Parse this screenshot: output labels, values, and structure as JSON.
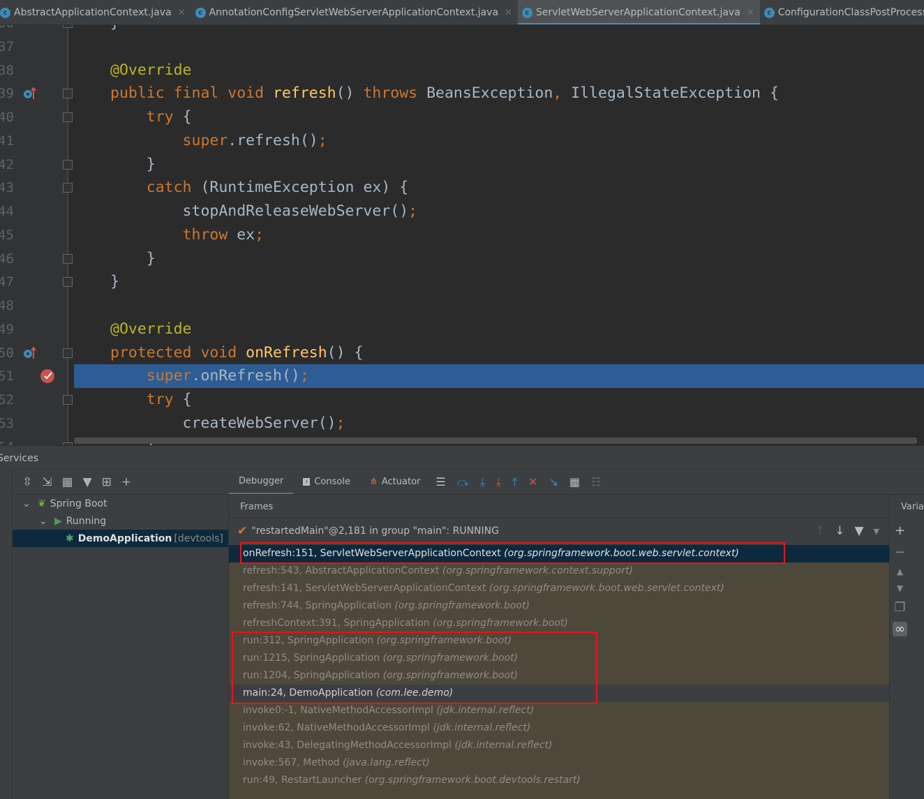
{
  "tabs": [
    {
      "label": "AbstractApplicationContext.java",
      "active": false
    },
    {
      "label": "AnnotationConfigServletWebServerApplicationContext.java",
      "active": false
    },
    {
      "label": "ServletWebServerApplicationContext.java",
      "active": true
    },
    {
      "label": "ConfigurationClassPostProcessor.java",
      "active": false
    }
  ],
  "editor": {
    "lines": [
      {
        "n": "36",
        "tokens": [
          [
            "}",
            "pl"
          ]
        ],
        "fold": true
      },
      {
        "n": "37",
        "tokens": []
      },
      {
        "n": "38",
        "tokens": [
          [
            "@Override",
            "an"
          ]
        ]
      },
      {
        "n": "39",
        "tokens": [
          [
            "public final void ",
            "kw"
          ],
          [
            "refresh",
            "md"
          ],
          [
            "() ",
            "pl"
          ],
          [
            "throws ",
            "kw"
          ],
          [
            "BeansException",
            "pl"
          ],
          [
            ", ",
            "kw"
          ],
          [
            "IllegalStateException {",
            "pl"
          ]
        ],
        "gutter": "override-icon",
        "fold": true
      },
      {
        "n": "40",
        "tokens": [
          [
            "    try ",
            "kw"
          ],
          [
            "{",
            "pl"
          ]
        ],
        "fold": true
      },
      {
        "n": "41",
        "tokens": [
          [
            "        super",
            "kw"
          ],
          [
            ".refresh()",
            "pl"
          ],
          [
            ";",
            "kw"
          ]
        ]
      },
      {
        "n": "42",
        "tokens": [
          [
            "    }",
            "pl"
          ]
        ],
        "fold": true
      },
      {
        "n": "43",
        "tokens": [
          [
            "    catch ",
            "kw"
          ],
          [
            "(RuntimeException ex) {",
            "pl"
          ]
        ],
        "fold": true
      },
      {
        "n": "44",
        "tokens": [
          [
            "        stopAndReleaseWebServer()",
            "pl"
          ],
          [
            ";",
            "kw"
          ]
        ]
      },
      {
        "n": "45",
        "tokens": [
          [
            "        throw ",
            "kw"
          ],
          [
            "ex",
            "pl"
          ],
          [
            ";",
            "kw"
          ]
        ]
      },
      {
        "n": "46",
        "tokens": [
          [
            "    }",
            "pl"
          ]
        ],
        "fold": true
      },
      {
        "n": "47",
        "tokens": [
          [
            "}",
            "pl"
          ]
        ],
        "fold": true
      },
      {
        "n": "48",
        "tokens": []
      },
      {
        "n": "49",
        "tokens": [
          [
            "@Override",
            "an"
          ]
        ]
      },
      {
        "n": "50",
        "tokens": [
          [
            "protected void ",
            "kw"
          ],
          [
            "onRefresh",
            "md"
          ],
          [
            "() {",
            "pl"
          ]
        ],
        "gutter": "override-icon",
        "fold": true
      },
      {
        "n": "51",
        "tokens": [
          [
            "    super",
            "kw"
          ],
          [
            ".onRefresh()",
            "pl"
          ],
          [
            ";",
            "kw"
          ]
        ],
        "gutter": "breakpoint-icon",
        "current": true
      },
      {
        "n": "52",
        "tokens": [
          [
            "    try ",
            "kw"
          ],
          [
            "{",
            "pl"
          ]
        ],
        "fold": true
      },
      {
        "n": "53",
        "tokens": [
          [
            "        createWebServer()",
            "pl"
          ],
          [
            ";",
            "kw"
          ]
        ]
      },
      {
        "n": "54",
        "tokens": [
          [
            "    }",
            "pl"
          ]
        ],
        "fold": true
      }
    ]
  },
  "services": {
    "title": "Services",
    "tree": [
      {
        "label": "Spring Boot",
        "extra": "",
        "icon": "spring-boot-icon"
      },
      {
        "label": "Running",
        "extra": "",
        "icon": "run-icon"
      },
      {
        "label": "DemoApplication",
        "extra": "[devtools]",
        "icon": "debug-bug-icon"
      }
    ]
  },
  "debugger": {
    "tabs": [
      "Debugger",
      "Console",
      "Actuator"
    ],
    "frames_title": "Frames",
    "variables_title": "Variables",
    "thread": "\"restartedMain\"@2,181 in group \"main\": RUNNING",
    "frames": [
      {
        "m": "onRefresh:151, ServletWebServerApplicationContext",
        "p": "(org.springframework.boot.web.servlet.context)",
        "state": "sel"
      },
      {
        "m": "refresh:543, AbstractApplicationContext",
        "p": "(org.springframework.context.support)"
      },
      {
        "m": "refresh:141, ServletWebServerApplicationContext",
        "p": "(org.springframework.boot.web.servlet.context)"
      },
      {
        "m": "refresh:744, SpringApplication",
        "p": "(org.springframework.boot)"
      },
      {
        "m": "refreshContext:391, SpringApplication",
        "p": "(org.springframework.boot)"
      },
      {
        "m": "run:312, SpringApplication",
        "p": "(org.springframework.boot)"
      },
      {
        "m": "run:1215, SpringApplication",
        "p": "(org.springframework.boot)"
      },
      {
        "m": "run:1204, SpringApplication",
        "p": "(org.springframework.boot)"
      },
      {
        "m": "main:24, DemoApplication",
        "p": "(com.lee.demo)",
        "state": "main"
      },
      {
        "m": "invoke0:-1, NativeMethodAccessorImpl",
        "p": "(jdk.internal.reflect)"
      },
      {
        "m": "invoke:62, NativeMethodAccessorImpl",
        "p": "(jdk.internal.reflect)"
      },
      {
        "m": "invoke:43, DelegatingMethodAccessorImpl",
        "p": "(jdk.internal.reflect)"
      },
      {
        "m": "invoke:567, Method",
        "p": "(java.lang.reflect)"
      },
      {
        "m": "run:49, RestartLauncher",
        "p": "(org.springframework.boot.devtools.restart)"
      }
    ]
  },
  "colors": {
    "keyword": "#cc7832",
    "annotation": "#bbb529",
    "method": "#ffc66d",
    "current_line": "#2d5d94",
    "highlight_box": "#e8141c"
  }
}
